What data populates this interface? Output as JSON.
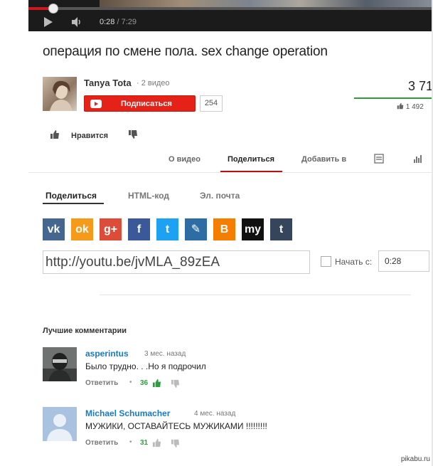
{
  "player": {
    "current_time": "0:28",
    "duration": "/ 7:29",
    "progress": 0.062
  },
  "video": {
    "title": "операция по смене пола. sex change operation"
  },
  "channel": {
    "name": "Tanya Tota",
    "video_count": "· 2 видео",
    "subscribe_label": "Подписаться",
    "subscriber_count": "254"
  },
  "stats": {
    "views": "3 71",
    "likes": "1 492",
    "like_ratio": 1.0
  },
  "actions": {
    "like_label": "Нравится"
  },
  "tabs": [
    "О видео",
    "Поделиться",
    "Добавить в"
  ],
  "share": {
    "subtabs": [
      "Поделиться",
      "HTML-код",
      "Эл. почта"
    ],
    "social": [
      {
        "name": "vk",
        "glyph": "vk",
        "color": "#45668e"
      },
      {
        "name": "odnoklassniki",
        "glyph": "ok",
        "color": "#f59a1a"
      },
      {
        "name": "google-plus",
        "glyph": "g+",
        "color": "#dd4b39"
      },
      {
        "name": "facebook",
        "glyph": "f",
        "color": "#3b5998"
      },
      {
        "name": "twitter",
        "glyph": "t",
        "color": "#1da1f2"
      },
      {
        "name": "livejournal",
        "glyph": "✎",
        "color": "#2e6da4"
      },
      {
        "name": "blogger",
        "glyph": "B",
        "color": "#f57d00"
      },
      {
        "name": "myspace",
        "glyph": "my",
        "color": "#111111"
      },
      {
        "name": "tumblr",
        "glyph": "t",
        "color": "#35465c"
      }
    ],
    "url": "http://youtu.be/jvMLA_89zEA",
    "start_label": "Начать с:",
    "start_value": "0:28"
  },
  "comments": {
    "heading": "Лучшие комментарии",
    "items": [
      {
        "author": "asperintus",
        "date": "3 мес. назад",
        "text": "Было трудно. . .Но я подрочил",
        "reply": "Ответить",
        "dot": "•",
        "likes": "36"
      },
      {
        "author": "Michael Schumacher",
        "date": "4 мес. назад",
        "text": "МУЖИКИ, ОСТАВАЙТЕСЬ МУЖИКАМИ !!!!!!!!!",
        "reply": "Ответить",
        "dot": "•",
        "likes": "31"
      }
    ]
  },
  "watermark": "pikabu.ru",
  "colors": {
    "accent_red": "#e62117",
    "link_blue": "#167ac6",
    "like_green": "#2c9e3d"
  }
}
